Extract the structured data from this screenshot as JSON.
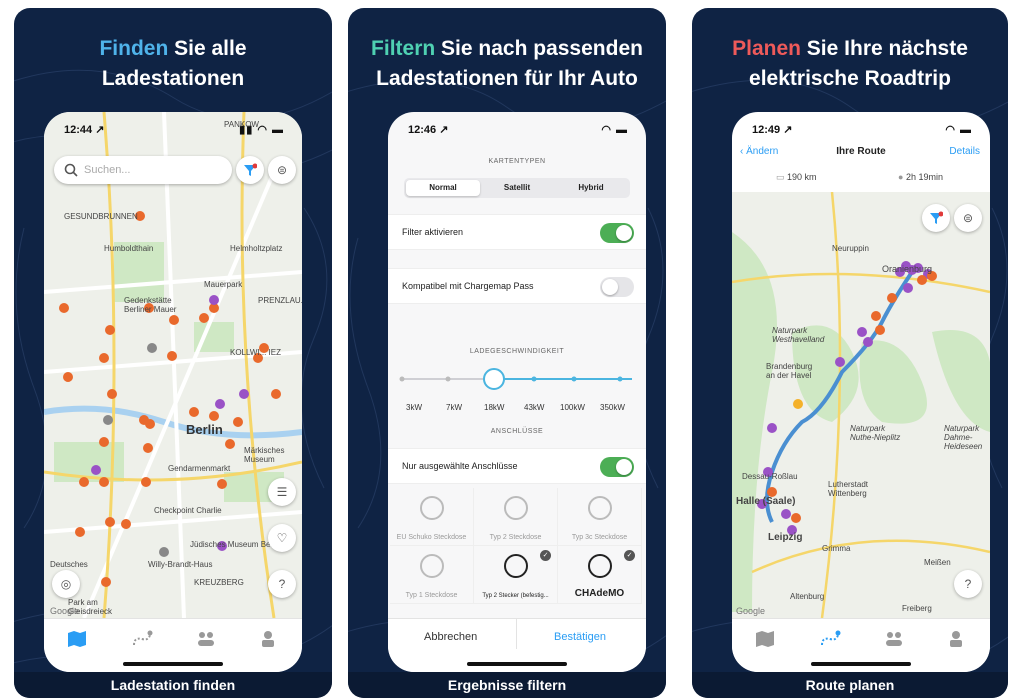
{
  "colors": {
    "panel_bg": "#0f2344",
    "accent_blue": "#4fb3ea",
    "accent_green": "#4fd1b2",
    "accent_red": "#ee5a5a",
    "toggle_on": "#4cae55",
    "link_blue": "#2a9df4",
    "route_line": "#4a8fd1",
    "pin_orange": "#e9692c",
    "pin_purple": "#9a52c6"
  },
  "panels": [
    {
      "headline_accent": "Finden",
      "headline_rest_1": " Sie alle",
      "headline_line2": "Ladestationen",
      "caption": "Ladestation finden"
    },
    {
      "headline_accent": "Filtern",
      "headline_rest_1": " Sie nach passenden",
      "headline_line2": "Ladestationen für Ihr Auto",
      "caption": "Ergebnisse filtern"
    },
    {
      "headline_accent": "Planen",
      "headline_rest_1": " Sie Ihre nächste",
      "headline_line2": "elektrische Roadtrip",
      "caption": "Route planen"
    }
  ],
  "phone1": {
    "time": "12:44 ↗",
    "search_placeholder": "Suchen...",
    "map_labels": {
      "gesundbrunnen": "GESUNDBRUNNEN",
      "pankow": "PANKOW",
      "humboldthain": "Humboldthain",
      "helmholtz": "Helmholtzplatz",
      "mauerpark": "Mauerpark",
      "gedenkstaette": "Gedenkstätte Berliner Mauer",
      "prenzlauer": "PRENZLAU...",
      "berlin": "Berlin",
      "kollwitz": "KOLLWI... IEZ",
      "gendarmen": "Gendarmenmarkt",
      "checkpoint": "Checkpoint Charlie",
      "juedisch": "Jüdisches Museum Berlin",
      "willy": "Willy-Brandt-Haus",
      "kreuzberg": "KREUZBERG",
      "deutsches": "Deutsches",
      "maerkisch": "Märkisches Museum",
      "park": "Park am Gleisdreieck",
      "google": "Google"
    }
  },
  "phone2": {
    "time": "12:46 ↗",
    "section_maptypes": "KARTENTYPEN",
    "maptypes": [
      "Normal",
      "Satellit",
      "Hybrid"
    ],
    "filter_toggle_label": "Filter aktivieren",
    "chargemap_label": "Kompatibel mit Chargemap Pass",
    "section_speed": "LADEGESCHWINDIGKEIT",
    "speeds": [
      "3kW",
      "7kW",
      "18kW",
      "43kW",
      "100kW",
      "350kW"
    ],
    "speed_selected_index": 2,
    "section_connectors": "ANSCHLÜSSE",
    "connectors_toggle_label": "Nur ausgewählte Anschlüsse",
    "connectors": [
      {
        "name": "EU Schuko Steckdose",
        "selected": false
      },
      {
        "name": "Typ 2 Steckdose",
        "selected": false
      },
      {
        "name": "Typ 3c Steckdose",
        "selected": false
      },
      {
        "name": "Typ 1 Steckdose",
        "selected": false
      },
      {
        "name": "Typ 2 Stecker (befestig...",
        "selected": true
      },
      {
        "name": "CHAdeMO",
        "selected": true
      }
    ],
    "cancel_label": "Abbrechen",
    "confirm_label": "Bestätigen"
  },
  "phone3": {
    "time": "12:49 ↗",
    "back_label": "Ändern",
    "title": "Ihre Route",
    "details_label": "Details",
    "distance": "190 km",
    "duration": "2h 19min",
    "map_labels": {
      "neuruppin": "Neuruppin",
      "oranienburg": "Oranienburg",
      "naturpark1": "Naturpark Westhavelland",
      "brandenburg": "Brandenburg an der Havel",
      "naturpark2": "Naturpark Nuthe-Nieplitz",
      "naturpark3": "Naturpark Dahme-Heideseen",
      "dessau": "Dessau-Roßlau",
      "lutherstadt": "Lutherstadt Wittenberg",
      "halle": "Halle (Saale)",
      "leipzig": "Leipzig",
      "grimma": "Grimma",
      "altenburg": "Altenburg",
      "meissen": "Meißen",
      "freiberg": "Freiberg",
      "google": "Google"
    }
  }
}
